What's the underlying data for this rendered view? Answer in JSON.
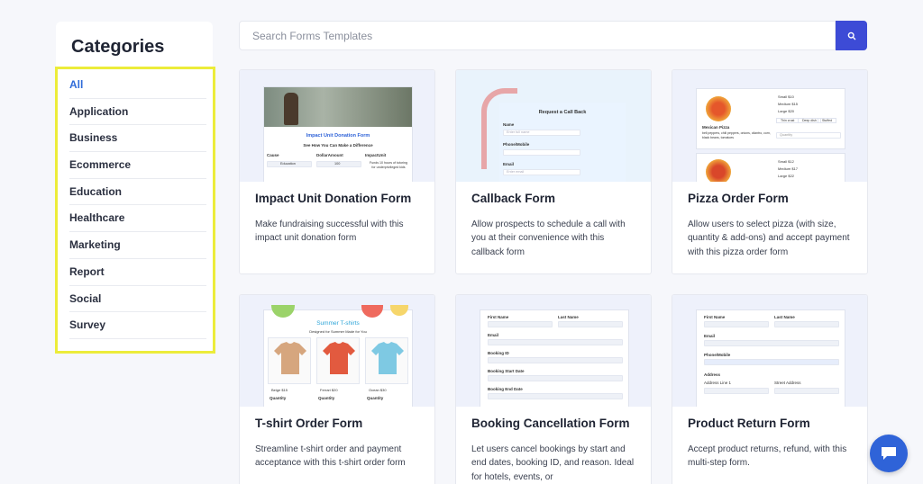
{
  "sidebar": {
    "title": "Categories",
    "items": [
      "All",
      "Application",
      "Business",
      "Ecommerce",
      "Education",
      "Healthcare",
      "Marketing",
      "Report",
      "Social",
      "Survey"
    ],
    "active_index": 0
  },
  "search": {
    "placeholder": "Search Forms Templates"
  },
  "cards": [
    {
      "title": "Impact Unit Donation Form",
      "desc": "Make fundraising successful with this impact unit donation form",
      "thumb": {
        "heading": "Impact Unit Donation Form",
        "subheading": "See How You Can Make a Difference",
        "cols": [
          "Cause",
          "DollarAmount",
          "ImpactUnit"
        ],
        "values": [
          "Education",
          "100",
          "Funds 10 hours of tutoring for underprivileged kids"
        ]
      }
    },
    {
      "title": "Callback Form",
      "desc": "Allow prospects to schedule a call with you at their convenience with this callback form",
      "thumb": {
        "heading": "Request a Call Back",
        "fields": [
          "Name",
          "Phone/Mobile",
          "Email"
        ],
        "placeholders": [
          "Enter full name",
          "",
          "Enter email"
        ]
      }
    },
    {
      "title": "Pizza Order Form",
      "desc": "Allow users to select pizza (with size, quantity & add-ons) and accept payment with this pizza order form",
      "thumb": {
        "item1_name": "Mexican Pizza",
        "item1_desc": "bell peppers, chili peppers, onions, cilantro, corn, black beans, tomatoes",
        "sizes1": [
          "Small $10",
          "Medium $15",
          "Large $20"
        ],
        "addons": [
          "Thin crust",
          "Deep dish",
          "Stuffed"
        ],
        "qty": "Quantity",
        "sizes2": [
          "Small $12",
          "Medium $17",
          "Large $22"
        ]
      }
    },
    {
      "title": "T-shirt Order Form",
      "desc": "Streamline t-shirt order and payment acceptance with this t-shirt order form",
      "thumb": {
        "heading": "Summer T-shirts",
        "subheading": "Designed for Summer Made for You",
        "items": [
          "Beige $15",
          "Ferrari $20",
          "Ocean $30"
        ],
        "qty": "Quantity"
      }
    },
    {
      "title": "Booking Cancellation Form",
      "desc": "Let users cancel bookings by start and end dates, booking ID, and reason. Ideal for hotels, events, or",
      "thumb": {
        "fields": [
          "First Name",
          "Last Name",
          "Email",
          "Booking ID",
          "Booking Start Date",
          "Booking End Date"
        ]
      }
    },
    {
      "title": "Product Return Form",
      "desc": "Accept product returns, refund, with this multi-step form.",
      "thumb": {
        "fields": [
          "First Name",
          "Last Name",
          "Email",
          "Phone/Mobile",
          "Address",
          "Address Line 1",
          "Street Address"
        ]
      }
    }
  ],
  "colors": {
    "accent": "#3d4bd6",
    "highlight": "#ecec3a",
    "active": "#2f6bd9",
    "chat": "#2f63d8"
  }
}
